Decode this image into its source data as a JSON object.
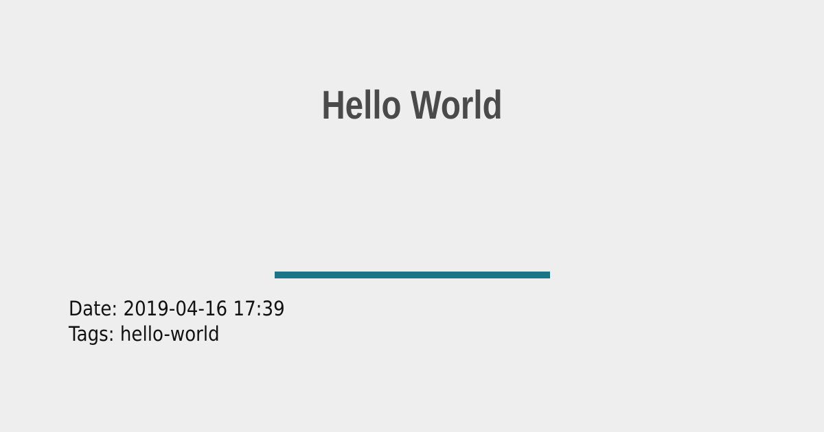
{
  "post": {
    "title": "Hello World",
    "date_label": "Date:",
    "date_value": "2019-04-16 17:39",
    "tags_label": "Tags:",
    "tags_value": "hello-world"
  },
  "colors": {
    "background": "#eeeeee",
    "title": "#4a4a4a",
    "accent": "#1b7586",
    "text": "#111111"
  }
}
